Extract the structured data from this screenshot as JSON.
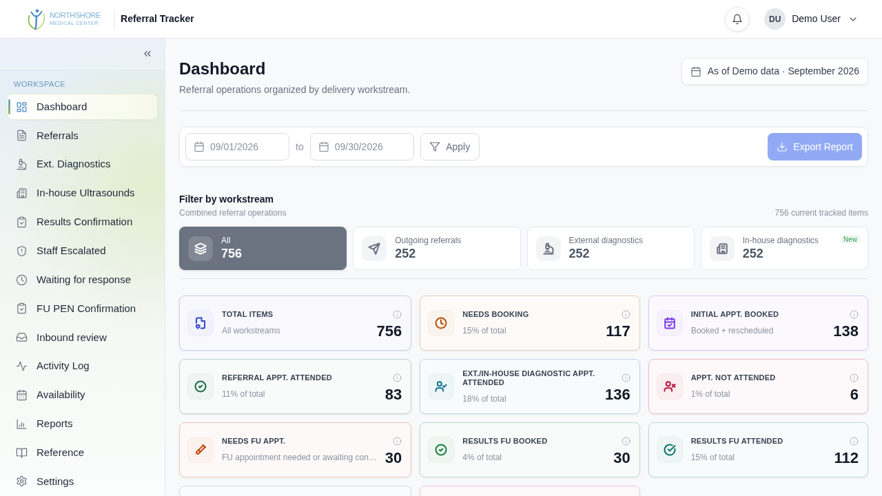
{
  "header": {
    "logo": {
      "line_1": "NORTHSHORE",
      "line_2": "MEDICAL CENTER"
    },
    "app_title": "Referral Tracker",
    "user": {
      "initials": "DU",
      "name": "Demo User"
    }
  },
  "sidebar": {
    "section": "WORKSPACE",
    "items": [
      {
        "label": "Dashboard",
        "selected": true
      },
      {
        "label": "Referrals",
        "selected": false
      },
      {
        "label": "Ext. Diagnostics",
        "selected": false
      },
      {
        "label": "In-house Ultrasounds",
        "selected": false
      },
      {
        "label": "Results Confirmation",
        "selected": false
      },
      {
        "label": "Staff Escalated",
        "selected": false
      },
      {
        "label": "Waiting for response",
        "selected": false
      },
      {
        "label": "FU PEN Confirmation",
        "selected": false
      },
      {
        "label": "Inbound review",
        "selected": false
      },
      {
        "label": "Activity Log",
        "selected": false
      },
      {
        "label": "Availability",
        "selected": false
      },
      {
        "label": "Reports",
        "selected": false
      },
      {
        "label": "Reference",
        "selected": false
      },
      {
        "label": "Settings",
        "selected": false
      }
    ]
  },
  "page": {
    "title": "Dashboard",
    "subtitle": "Referral operations organized by delivery workstream.",
    "as_of": "As of Demo data · September 2026"
  },
  "date_filter": {
    "start_date": "09/01/2026",
    "separator": "to",
    "end_date": "09/30/2026",
    "apply": "Apply",
    "export": {
      "label": "Export Report",
      "disabled": true
    }
  },
  "workstreams": {
    "title": "Filter by workstream",
    "subtitle": "Combined referral operations",
    "summary": "756 current tracked items",
    "items": [
      {
        "label": "All",
        "count": "756",
        "selected": true
      },
      {
        "label": "Outgoing referrals",
        "count": "252",
        "selected": false
      },
      {
        "label": "External diagnostics",
        "count": "252",
        "selected": false
      },
      {
        "label": "In-house diagnostics",
        "count": "252",
        "selected": false,
        "badge": "New"
      }
    ]
  },
  "cards": [
    {
      "title": "TOTAL ITEMS",
      "note": "All workstreams",
      "value": "756",
      "color": "#3347c9"
    },
    {
      "title": "NEEDS BOOKING",
      "note": "15% of total",
      "value": "117",
      "color": "#b4540a"
    },
    {
      "title": "INITIAL APPT. BOOKED",
      "note": "Booked + rescheduled",
      "value": "138",
      "color": "#7c3aed"
    },
    {
      "title": "REFERRAL APPT. ATTENDED",
      "note": "11% of total",
      "value": "83",
      "color": "#166a4a"
    },
    {
      "title": "EXT./IN-HOUSE DIAGNOSTIC APPT. ATTENDED",
      "note": "18% of total",
      "value": "136",
      "color": "#0e7490"
    },
    {
      "title": "APPT. NOT ATTENDED",
      "note": "1% of total",
      "value": "6",
      "color": "#be123c"
    },
    {
      "title": "NEEDS FU APPT.",
      "note": "FU appointment needed or awaiting con…",
      "value": "30",
      "color": "#c2410c"
    },
    {
      "title": "RESULTS FU BOOKED",
      "note": "4% of total",
      "value": "30",
      "color": "#15803d"
    },
    {
      "title": "RESULTS FU ATTENDED",
      "note": "15% of total",
      "value": "112",
      "color": "#0f766e"
    },
    {
      "color": "#d6dce6"
    },
    {
      "color": "#f0c8d2"
    }
  ]
}
